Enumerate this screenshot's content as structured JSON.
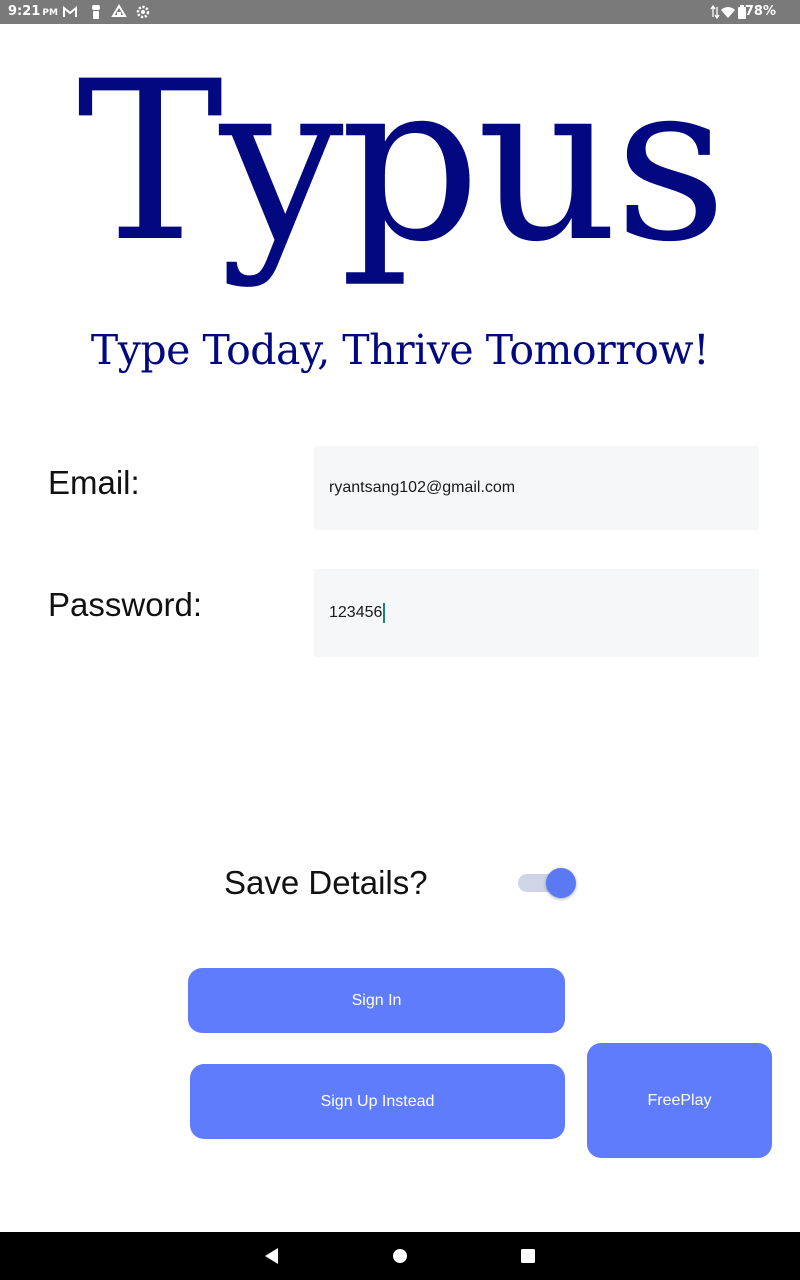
{
  "status_bar": {
    "time": "9:21",
    "ampm": "PM",
    "battery": "78%",
    "left_icons": [
      "gmail-icon",
      "figure-icon",
      "drive-icon",
      "settings-icon"
    ],
    "right_icons": [
      "data-arrows-icon",
      "wifi-icon",
      "battery-icon"
    ]
  },
  "app": {
    "logo": "Typus",
    "tagline": "Type Today, Thrive Tomorrow!"
  },
  "form": {
    "email_label": "Email:",
    "email_value": "ryantsang102@gmail.com",
    "password_label": "Password:",
    "password_value": "123456",
    "save_label": "Save Details?",
    "save_toggle_on": true
  },
  "buttons": {
    "sign_in": "Sign In",
    "sign_up": "Sign Up Instead",
    "freeplay": "FreePlay"
  },
  "nav_bar": {
    "icons": [
      "back-icon",
      "home-icon",
      "recents-icon"
    ]
  },
  "colors": {
    "brand_navy": "#02087f",
    "button_blue": "#5f7cfc",
    "toggle_thumb": "#5a79f2",
    "status_bar": "#7a7a7a"
  }
}
